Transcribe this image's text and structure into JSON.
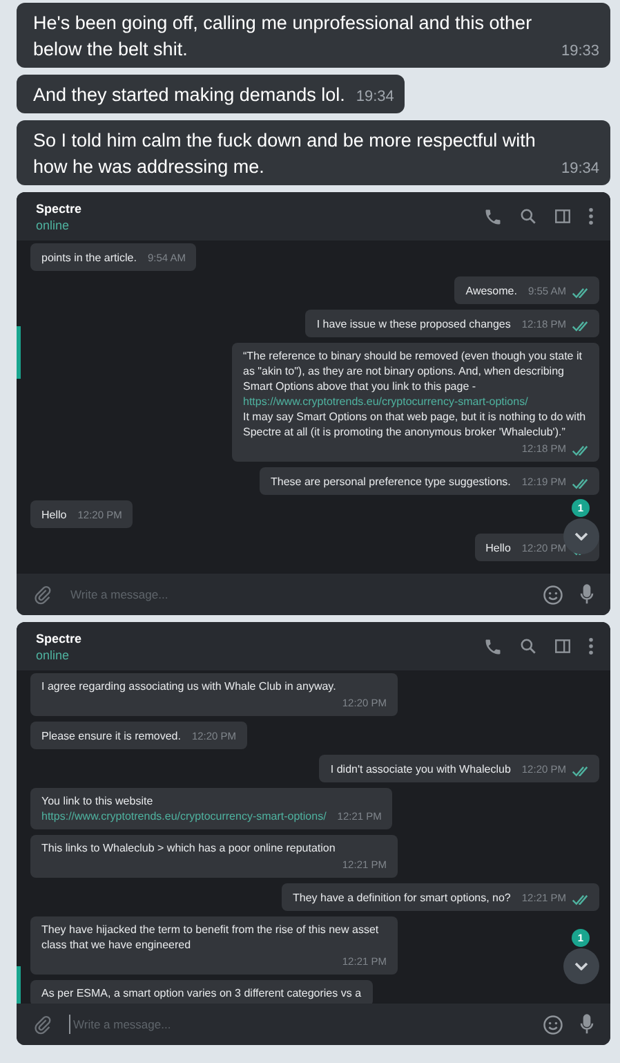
{
  "top_messages": [
    {
      "text": "He's been going off, calling me unprofessional and this other below the belt shit.",
      "time": "19:33"
    },
    {
      "text": "And they started making demands lol.",
      "time": "19:34"
    },
    {
      "text": "So I told him calm the fuck down and be more respectful with how he was addressing me.",
      "time": "19:34"
    }
  ],
  "chats": [
    {
      "contact": {
        "name": "Spectre",
        "status": "online"
      },
      "messages": [
        {
          "kind": "incoming",
          "parts": [
            {
              "kind": "text",
              "text": "points in the article."
            }
          ],
          "time": "9:54 AM"
        },
        {
          "kind": "outgoing",
          "parts": [
            {
              "kind": "text",
              "text": "Awesome."
            }
          ],
          "time": "9:55 AM",
          "read": true
        },
        {
          "kind": "outgoing",
          "parts": [
            {
              "kind": "text",
              "text": "I have issue w these proposed changes"
            }
          ],
          "time": "12:18 PM",
          "read": true
        },
        {
          "kind": "outgoing",
          "parts": [
            {
              "kind": "text",
              "text": "“The reference to binary should be removed (even though you state it as \"akin to\"), as they are not binary options.  And, when describing Smart Options above that you link to this page -"
            },
            {
              "kind": "link",
              "text": "https://www.cryptotrends.eu/cryptocurrency-smart-options/"
            },
            {
              "kind": "text",
              "text": "It may say Smart Options on that web page, but it is nothing to do with Spectre at all  (it is promoting the anonymous broker 'Whaleclub').”"
            }
          ],
          "time": "12:18 PM",
          "read": true
        },
        {
          "kind": "outgoing",
          "parts": [
            {
              "kind": "text",
              "text": "These are personal preference type suggestions."
            }
          ],
          "time": "12:19 PM",
          "read": true
        },
        {
          "kind": "incoming",
          "parts": [
            {
              "kind": "text",
              "text": "Hello"
            }
          ],
          "time": "12:20 PM"
        },
        {
          "kind": "outgoing",
          "parts": [
            {
              "kind": "text",
              "text": "Hello"
            }
          ],
          "time": "12:20 PM",
          "read": true
        }
      ],
      "unread_badge": "1",
      "composer": {
        "placeholder": "Write a message...",
        "focused": false
      }
    },
    {
      "contact": {
        "name": "Spectre",
        "status": "online"
      },
      "messages": [
        {
          "kind": "incoming",
          "parts": [
            {
              "kind": "text",
              "text": "I agree regarding associating us with Whale Club in anyway."
            }
          ],
          "time": "12:20 PM"
        },
        {
          "kind": "incoming",
          "parts": [
            {
              "kind": "text",
              "text": "Please ensure it is removed."
            }
          ],
          "time": "12:20 PM"
        },
        {
          "kind": "outgoing",
          "parts": [
            {
              "kind": "text",
              "text": "I didn't associate you with Whaleclub"
            }
          ],
          "time": "12:20 PM",
          "read": true
        },
        {
          "kind": "incoming",
          "parts": [
            {
              "kind": "text",
              "text": "You link to this website"
            },
            {
              "kind": "link",
              "text": "https://www.cryptotrends.eu/cryptocurrency-smart-options/"
            }
          ],
          "time": "12:21 PM"
        },
        {
          "kind": "incoming",
          "parts": [
            {
              "kind": "text",
              "text": "This links to Whaleclub > which has a poor online reputation"
            }
          ],
          "time": "12:21 PM"
        },
        {
          "kind": "outgoing",
          "parts": [
            {
              "kind": "text",
              "text": "They have a definition for smart options, no?"
            }
          ],
          "time": "12:21 PM",
          "read": true
        },
        {
          "kind": "incoming",
          "parts": [
            {
              "kind": "text",
              "text": "They have hijacked the term to benefit from the rise of this new asset class that we have engineered"
            }
          ],
          "time": "12:21 PM"
        },
        {
          "kind": "incoming",
          "parts": [
            {
              "kind": "text",
              "text": "As per ESMA, a smart option varies on 3 different categories vs a"
            }
          ]
        }
      ],
      "unread_badge": "1",
      "composer": {
        "placeholder": "Write a message...",
        "focused": true
      }
    }
  ]
}
